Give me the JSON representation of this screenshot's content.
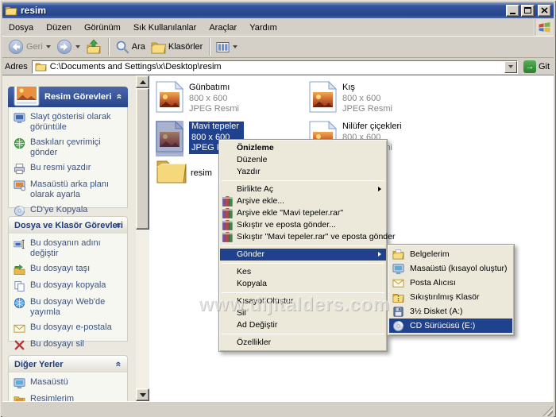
{
  "window": {
    "title": "resim"
  },
  "menubar": {
    "items": [
      "Dosya",
      "Düzen",
      "Görünüm",
      "Sık Kullanılanlar",
      "Araçlar",
      "Yardım"
    ]
  },
  "toolbar": {
    "back": "Geri",
    "search": "Ara",
    "folders": "Klasörler"
  },
  "addressbar": {
    "label": "Adres",
    "path": "C:\\Documents and Settings\\x\\Desktop\\resim",
    "go": "Git"
  },
  "sidebar": {
    "panels": [
      {
        "title": "Resim Görevleri",
        "items": [
          {
            "icon": "slideshow-icon",
            "label": "Slayt gösterisi olarak görüntüle"
          },
          {
            "icon": "order-prints-icon",
            "label": "Baskıları çevrimiçi gönder"
          },
          {
            "icon": "print-icon",
            "label": "Bu resmi yazdır"
          },
          {
            "icon": "wallpaper-icon",
            "label": "Masaüstü arka planı olarak ayarla"
          },
          {
            "icon": "copy-cd-icon",
            "label": "CD'ye Kopyala"
          }
        ]
      },
      {
        "title": "Dosya ve Klasör Görevleri",
        "items": [
          {
            "icon": "rename-icon",
            "label": "Bu dosyanın adını değiştir"
          },
          {
            "icon": "move-icon",
            "label": "Bu dosyayı taşı"
          },
          {
            "icon": "copy-icon",
            "label": "Bu dosyayı kopyala"
          },
          {
            "icon": "publish-web-icon",
            "label": "Bu dosyayı Web'de yayımla"
          },
          {
            "icon": "email-icon",
            "label": "Bu dosyayı e-postala"
          },
          {
            "icon": "delete-icon",
            "label": "Bu dosyayı sil"
          }
        ]
      },
      {
        "title": "Diğer Yerler",
        "items": [
          {
            "icon": "desktop-icon",
            "label": "Masaüstü"
          },
          {
            "icon": "my-pictures-icon",
            "label": "Resimlerim"
          }
        ]
      }
    ]
  },
  "files": {
    "items": [
      {
        "name": "Günbatımı",
        "dimensions": "800 x 600",
        "type": "JPEG Resmi",
        "selected": false
      },
      {
        "name": "Kış",
        "dimensions": "800 x 600",
        "type": "JPEG Resmi",
        "selected": false
      },
      {
        "name": "Mavi tepeler",
        "dimensions": "800 x 600",
        "type": "JPEG Resmi",
        "selected": true
      },
      {
        "name": "Nilüfer çiçekleri",
        "dimensions": "800 x 600",
        "type": "JPEG Resmi",
        "selected": false
      }
    ],
    "folder": {
      "name": "resim"
    }
  },
  "context_menu": {
    "items": [
      {
        "label": "Önizleme",
        "bold": true
      },
      {
        "label": "Düzenle"
      },
      {
        "label": "Yazdır"
      },
      {
        "label": "Birlikte Aç",
        "has_submenu": true
      },
      {
        "label": "Arşive ekle...",
        "icon": "winrar-icon"
      },
      {
        "label": "Arşive ekle \"Mavi tepeler.rar\"",
        "icon": "winrar-icon"
      },
      {
        "label": "Sıkıştır ve eposta gönder...",
        "icon": "winrar-icon"
      },
      {
        "label": "Sıkıştır \"Mavi tepeler.rar\" ve eposta gönder",
        "icon": "winrar-icon"
      },
      {
        "label": "Gönder",
        "has_submenu": true,
        "highlighted": true
      },
      {
        "label": "Kes"
      },
      {
        "label": "Kopyala"
      },
      {
        "label": "Kısayol Oluştur"
      },
      {
        "label": "Sil"
      },
      {
        "label": "Ad Değiştir"
      },
      {
        "label": "Özellikler"
      }
    ]
  },
  "send_to_menu": {
    "items": [
      {
        "icon": "documents-icon",
        "label": "Belgelerim"
      },
      {
        "icon": "desktop-shortcut-icon",
        "label": "Masaüstü (kısayol oluştur)"
      },
      {
        "icon": "mail-icon",
        "label": "Posta Alıcısı"
      },
      {
        "icon": "zip-folder-icon",
        "label": "Sıkıştırılmış Klasör"
      },
      {
        "icon": "floppy-icon",
        "label": "3½ Disket (A:)"
      },
      {
        "icon": "cd-drive-icon",
        "label": "CD Sürücüsü (E:)",
        "highlighted": true
      }
    ]
  },
  "watermark": "www.dijitalders.com",
  "colors": {
    "titlebar": "#26458c",
    "selection": "#20418c",
    "menu_bg": "#ece9db",
    "task_link": "#3a5280"
  }
}
